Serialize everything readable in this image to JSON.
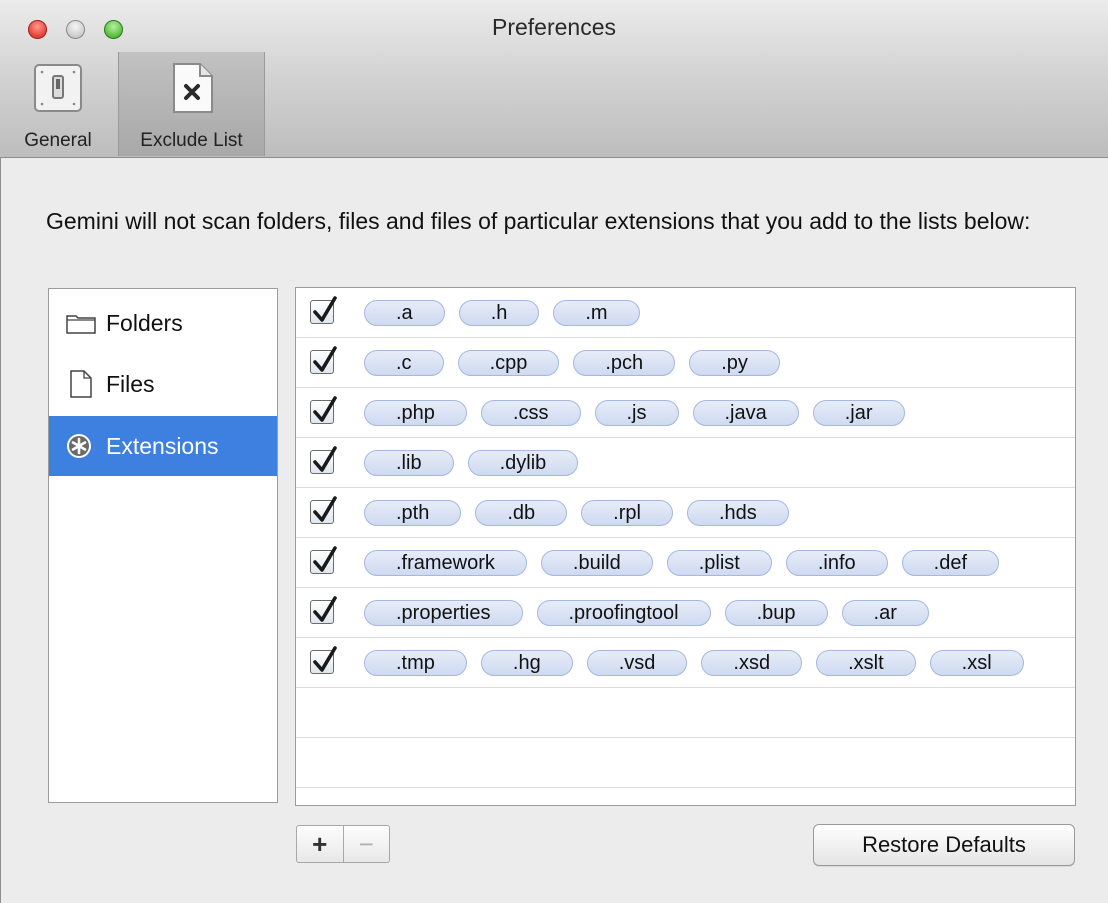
{
  "window": {
    "title": "Preferences"
  },
  "toolbar": {
    "items": [
      {
        "label": "General",
        "icon": "switch-icon"
      },
      {
        "label": "Exclude List",
        "icon": "document-x-icon",
        "selected": true
      }
    ]
  },
  "description": "Gemini will not scan folders, files and files of particular extensions that you add to the lists below:",
  "sidebar": {
    "items": [
      {
        "label": "Folders",
        "icon": "folder-icon",
        "selected": false
      },
      {
        "label": "Files",
        "icon": "file-icon",
        "selected": false
      },
      {
        "label": "Extensions",
        "icon": "asterisk-badge-icon",
        "selected": true
      }
    ]
  },
  "extensions": {
    "rows": [
      {
        "checked": true,
        "tags": [
          ".a",
          ".h",
          ".m"
        ]
      },
      {
        "checked": true,
        "tags": [
          ".c",
          ".cpp",
          ".pch",
          ".py"
        ]
      },
      {
        "checked": true,
        "tags": [
          ".php",
          ".css",
          ".js",
          ".java",
          ".jar"
        ]
      },
      {
        "checked": true,
        "tags": [
          ".lib",
          ".dylib"
        ]
      },
      {
        "checked": true,
        "tags": [
          ".pth",
          ".db",
          ".rpl",
          ".hds"
        ]
      },
      {
        "checked": true,
        "tags": [
          ".framework",
          ".build",
          ".plist",
          ".info",
          ".def"
        ]
      },
      {
        "checked": true,
        "tags": [
          ".properties",
          ".proofingtool",
          ".bup",
          ".ar"
        ]
      },
      {
        "checked": true,
        "tags": [
          ".tmp",
          ".hg",
          ".vsd",
          ".xsd",
          ".xslt",
          ".xsl"
        ]
      }
    ]
  },
  "controls": {
    "add_label": "+",
    "remove_label": "−",
    "restore_label": "Restore Defaults"
  }
}
